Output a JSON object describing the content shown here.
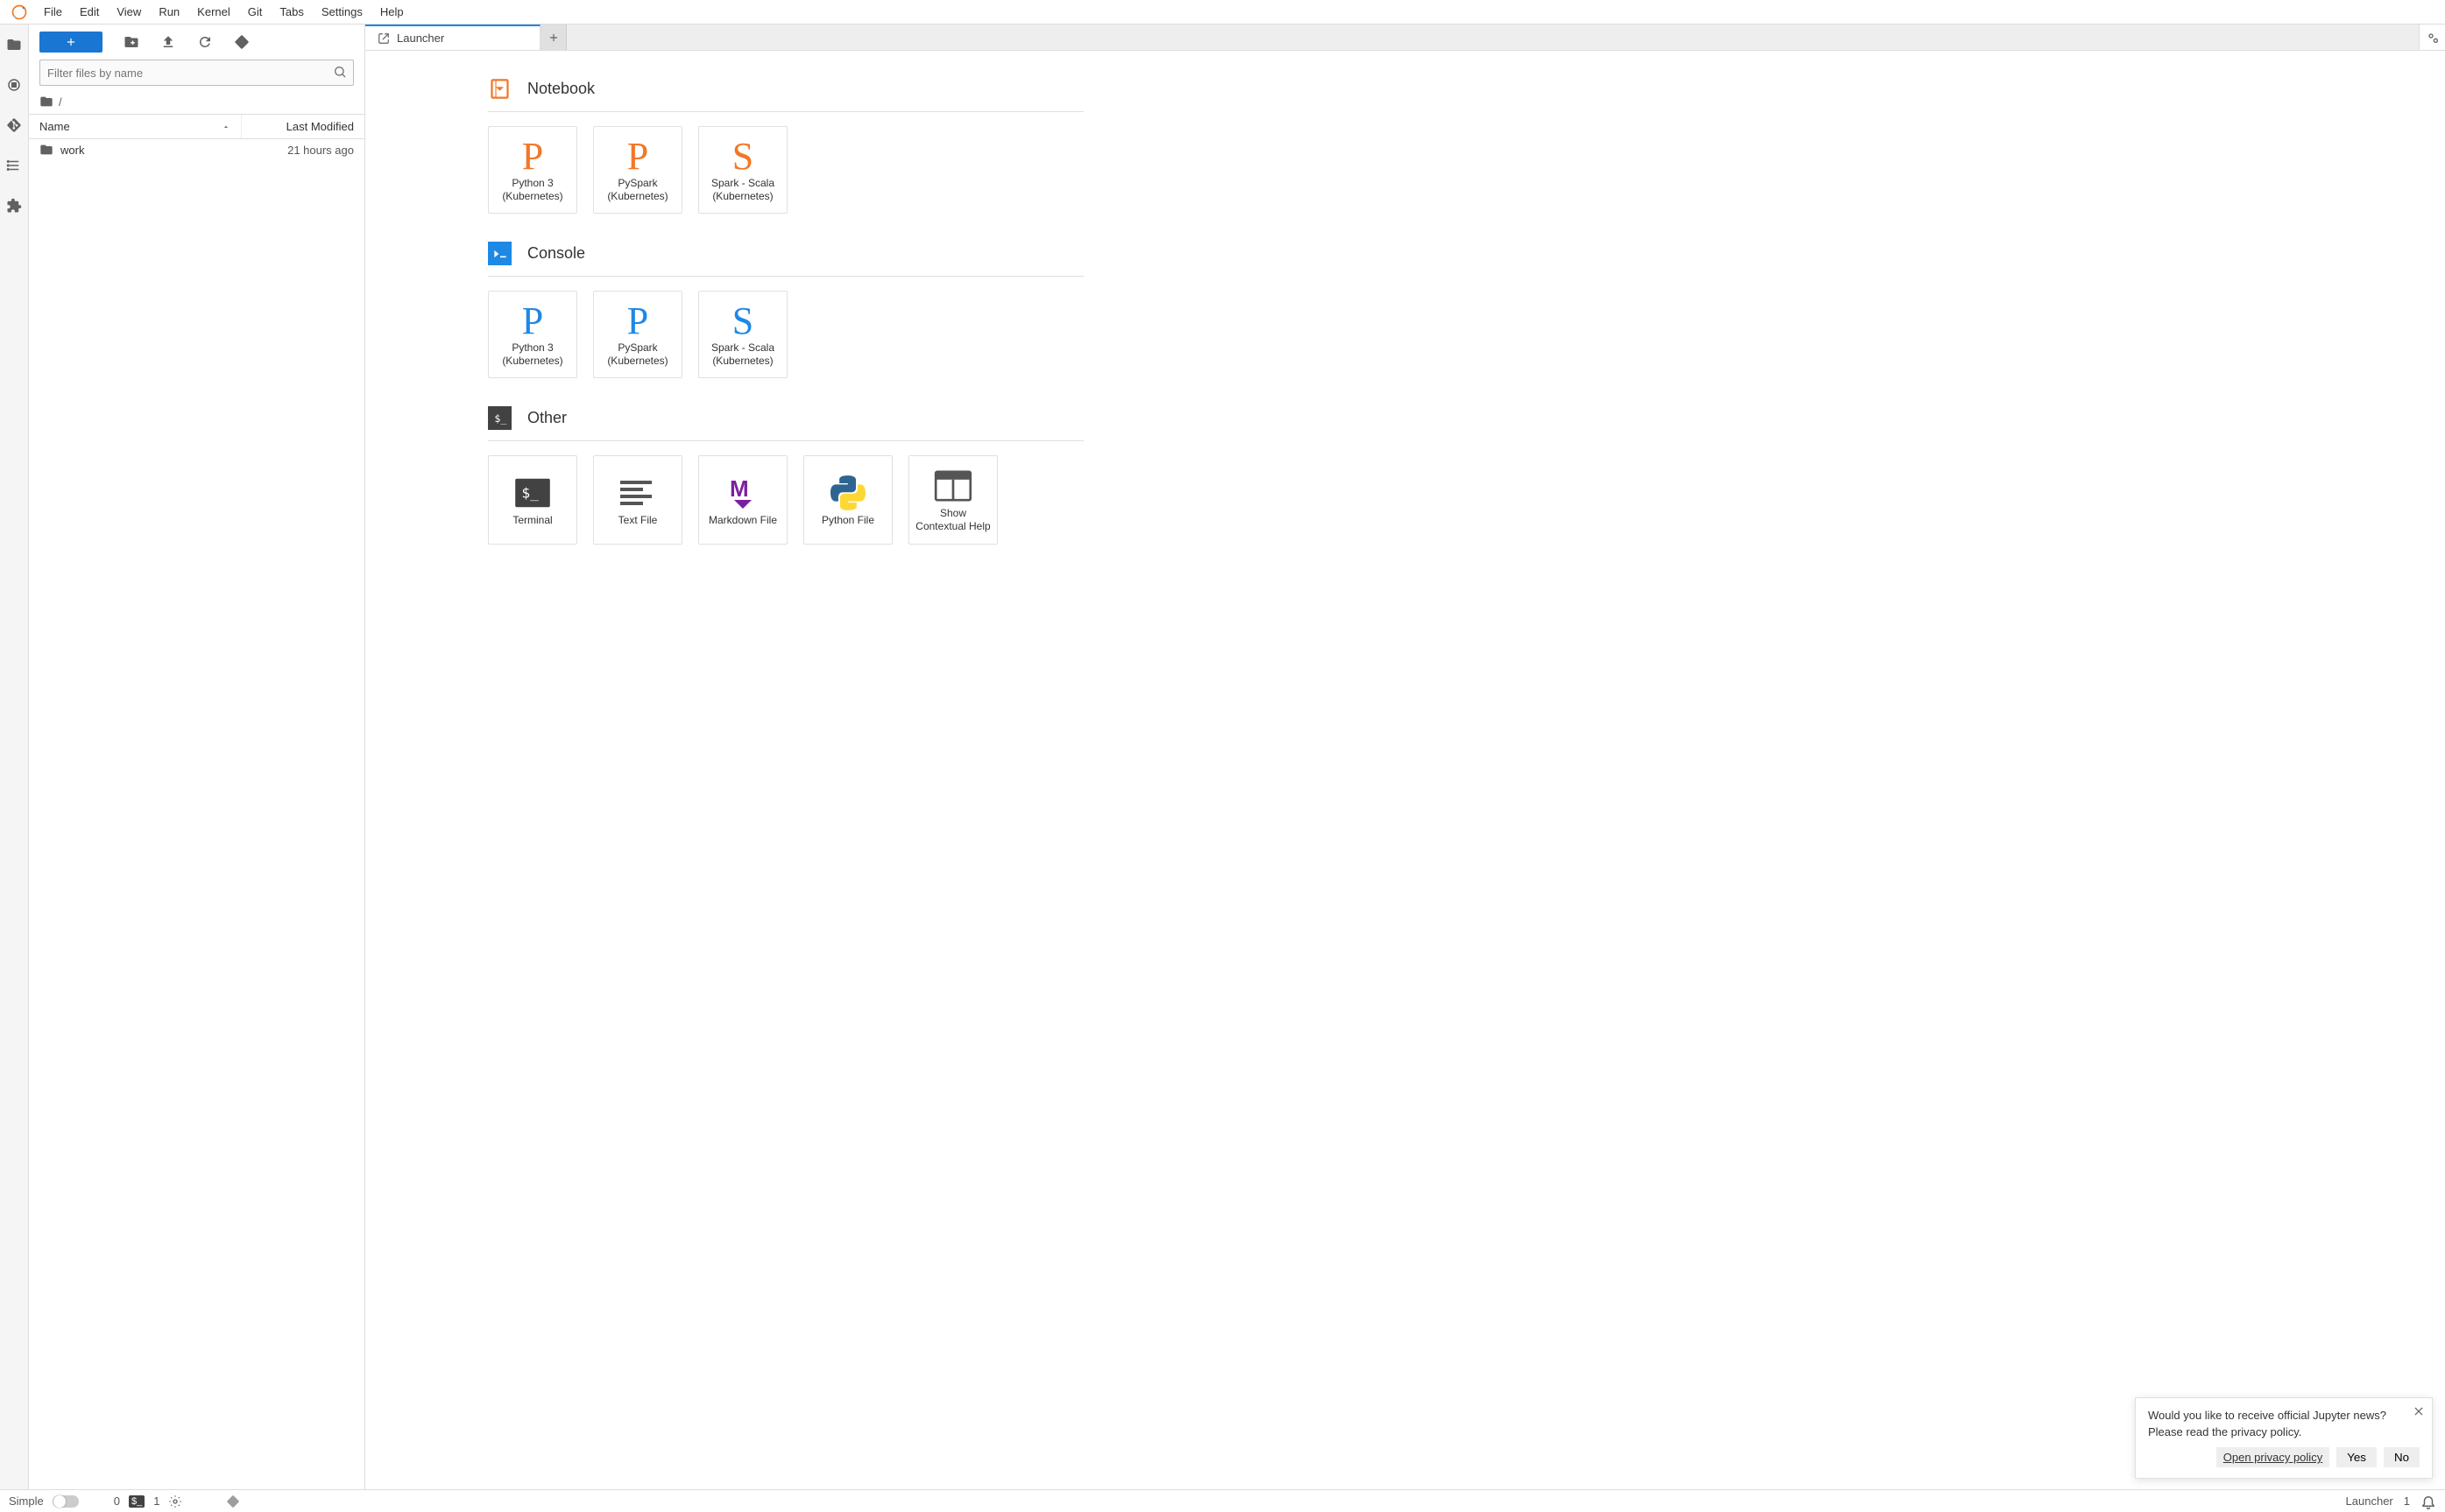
{
  "menu": [
    "File",
    "Edit",
    "View",
    "Run",
    "Kernel",
    "Git",
    "Tabs",
    "Settings",
    "Help"
  ],
  "filebrowser": {
    "filter_placeholder": "Filter files by name",
    "breadcrumb_root": "/",
    "columns": {
      "name": "Name",
      "modified": "Last Modified"
    },
    "items": [
      {
        "name": "work",
        "modified": "21 hours ago",
        "kind": "folder"
      }
    ]
  },
  "tabs": {
    "active": {
      "title": "Launcher"
    }
  },
  "launcher": {
    "sections": [
      {
        "id": "notebook",
        "title": "Notebook",
        "icon": "notebook-icon",
        "color": "#f37726",
        "cards": [
          {
            "letter": "P",
            "label_line1": "Python 3",
            "label_line2": "(Kubernetes)"
          },
          {
            "letter": "P",
            "label_line1": "PySpark",
            "label_line2": "(Kubernetes)"
          },
          {
            "letter": "S",
            "label_line1": "Spark - Scala",
            "label_line2": "(Kubernetes)"
          }
        ]
      },
      {
        "id": "console",
        "title": "Console",
        "icon": "console-icon",
        "color": "#1e88e5",
        "cards": [
          {
            "letter": "P",
            "label_line1": "Python 3",
            "label_line2": "(Kubernetes)"
          },
          {
            "letter": "P",
            "label_line1": "PySpark",
            "label_line2": "(Kubernetes)"
          },
          {
            "letter": "S",
            "label_line1": "Spark - Scala",
            "label_line2": "(Kubernetes)"
          }
        ]
      },
      {
        "id": "other",
        "title": "Other",
        "icon": "terminal-icon",
        "color": "#424242",
        "cards": [
          {
            "icon": "terminal",
            "label_line1": "Terminal",
            "label_line2": ""
          },
          {
            "icon": "textfile",
            "label_line1": "Text File",
            "label_line2": ""
          },
          {
            "icon": "markdown",
            "label_line1": "Markdown File",
            "label_line2": ""
          },
          {
            "icon": "python",
            "label_line1": "Python File",
            "label_line2": ""
          },
          {
            "icon": "contexthelp",
            "label_line1": "Show",
            "label_line2": "Contextual Help"
          }
        ]
      }
    ]
  },
  "notification": {
    "line1": "Would you like to receive official Jupyter news?",
    "line2": "Please read the privacy policy.",
    "link": "Open privacy policy",
    "yes": "Yes",
    "no": "No"
  },
  "statusbar": {
    "simple": "Simple",
    "terminals_count": "0",
    "consoles_count": "1",
    "right_label": "Launcher",
    "right_count": "1"
  }
}
